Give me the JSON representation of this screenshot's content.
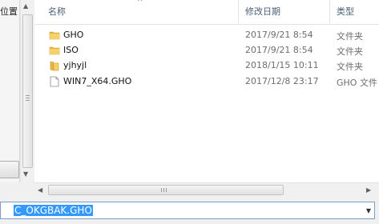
{
  "left_pane": {
    "location_text": "位置"
  },
  "columns": {
    "name": "名称",
    "modified": "修改日期",
    "type": "类型"
  },
  "files": [
    {
      "name": "GHO",
      "date": "2017/9/21 8:54",
      "type": "文件夹",
      "icon": "folder-icon"
    },
    {
      "name": "ISO",
      "date": "2017/9/21 8:54",
      "type": "文件夹",
      "icon": "folder-icon"
    },
    {
      "name": "yjhyjl",
      "date": "2018/1/15 10:11",
      "type": "文件夹",
      "icon": "folder-icon"
    },
    {
      "name": "WIN7_X64.GHO",
      "date": "2017/12/8 23:17",
      "type": "GHO 文件",
      "icon": "file-icon"
    }
  ],
  "filename": {
    "value": "C_OKGBAK.GHO"
  },
  "colors": {
    "selection": "#3399ff",
    "folder": "#f2c14e",
    "header_text": "#4c607a"
  }
}
